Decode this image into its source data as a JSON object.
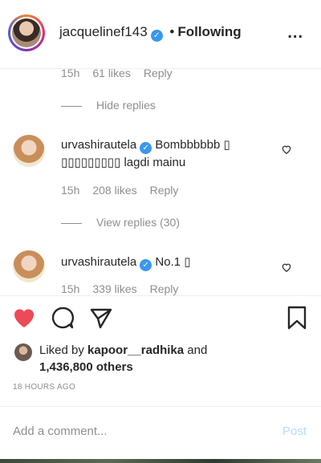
{
  "header": {
    "username": "jacquelinef143",
    "separator": "•",
    "follow_status": "Following",
    "more_label": "..."
  },
  "comments": {
    "prev_meta": {
      "time": "15h",
      "likes": "61 likes",
      "reply": "Reply"
    },
    "hide_replies": "Hide replies",
    "items": [
      {
        "username": "urvashirautela",
        "text": "Bombbbbbb ▯ ▯▯▯▯▯▯▯▯▯ lagdi mainu",
        "time": "15h",
        "likes": "208 likes",
        "reply": "Reply",
        "view_replies": "View replies (30)"
      },
      {
        "username": "urvashirautela",
        "text": "No.1 ▯",
        "time": "15h",
        "likes": "339 likes",
        "reply": "Reply"
      }
    ]
  },
  "actions": {
    "like_icon": "heart-filled-icon",
    "comment_icon": "comment-icon",
    "share_icon": "send-icon",
    "save_icon": "bookmark-icon",
    "like_color": "#ed4956"
  },
  "likes": {
    "prefix": "Liked by",
    "user": "kapoor__radhika",
    "and": "and",
    "others": "1,436,800 others"
  },
  "timestamp": "18 HOURS AGO",
  "add_comment": {
    "placeholder": "Add a comment...",
    "post_label": "Post"
  }
}
